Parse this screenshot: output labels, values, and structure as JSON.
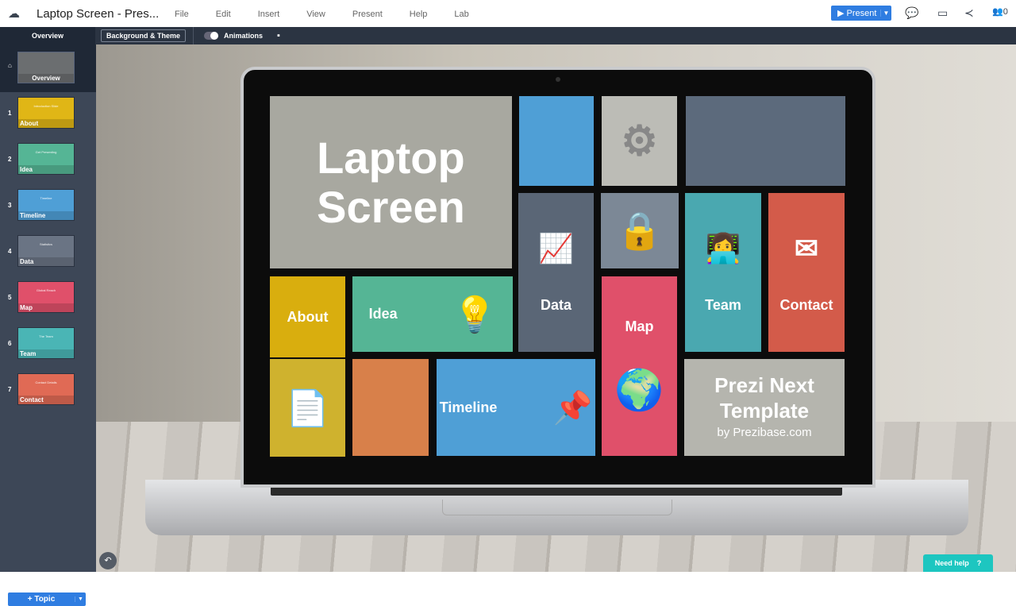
{
  "topbar": {
    "title": "Laptop Screen - Pres...",
    "menu": [
      "File",
      "Edit",
      "Insert",
      "View",
      "Present",
      "Help",
      "Lab"
    ],
    "present_label": "Present",
    "collaborators": "0"
  },
  "toolbar": {
    "overview": "Overview",
    "background_theme": "Background & Theme",
    "animations": "Animations"
  },
  "sidebar": {
    "home_label": "Overview",
    "items": [
      {
        "num": "1",
        "label": "About",
        "sub": "Introduction Slide",
        "color": "#e0b616"
      },
      {
        "num": "2",
        "label": "Idea",
        "sub": "Get Presenting",
        "color": "#55b595"
      },
      {
        "num": "3",
        "label": "Timeline",
        "sub": "Timeline",
        "color": "#4f9fd6"
      },
      {
        "num": "4",
        "label": "Data",
        "sub": "Statistics",
        "color": "#6a7484"
      },
      {
        "num": "5",
        "label": "Map",
        "sub": "Global Reach",
        "color": "#e0506a"
      },
      {
        "num": "6",
        "label": "Team",
        "sub": "The Team",
        "color": "#4ab5b5"
      },
      {
        "num": "7",
        "label": "Contact",
        "sub": "Contact Details",
        "color": "#e06a55"
      }
    ],
    "add_topic": "+ Topic"
  },
  "canvas": {
    "title_line1": "Laptop",
    "title_line2": "Screen",
    "about": "About",
    "idea": "Idea",
    "data": "Data",
    "map": "Map",
    "team": "Team",
    "contact": "Contact",
    "timeline": "Timeline",
    "prezi_line1": "Prezi Next",
    "prezi_line2": "Template",
    "prezi_by": "by Prezibase.com"
  },
  "help": {
    "label": "Need help"
  }
}
